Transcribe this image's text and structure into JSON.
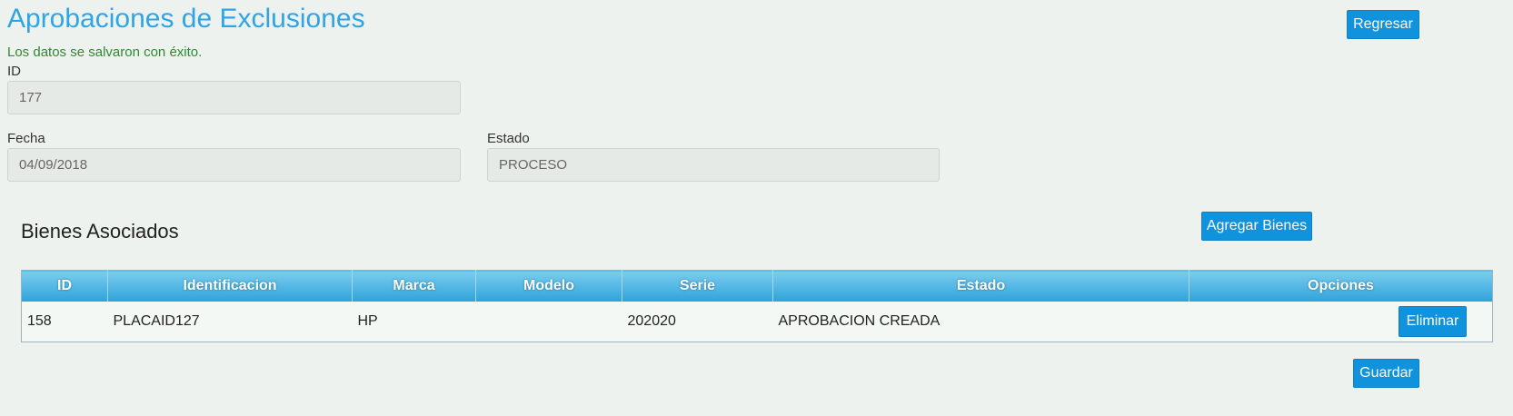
{
  "page": {
    "title": "Aprobaciones de Exclusiones",
    "success_message": "Los datos se salvaron con éxito.",
    "back_button": "Regresar",
    "save_button": "Guardar"
  },
  "form": {
    "id_label": "ID",
    "id_value": "177",
    "fecha_label": "Fecha",
    "fecha_value": "04/09/2018",
    "estado_label": "Estado",
    "estado_value": "PROCESO"
  },
  "assets": {
    "section_title": "Bienes Asociados",
    "add_button": "Agregar Bienes",
    "columns": [
      "ID",
      "Identificacion",
      "Marca",
      "Modelo",
      "Serie",
      "Estado",
      "Opciones"
    ],
    "rows": [
      {
        "id": "158",
        "identificacion": "PLACAID127",
        "marca": "HP",
        "modelo": "",
        "serie": "202020",
        "estado": "APROBACION CREADA",
        "action": "Eliminar"
      }
    ]
  },
  "colors": {
    "accent": "#2fa4e7",
    "button": "#1192dd",
    "success": "#2e8b2e",
    "background": "#eef2ef"
  }
}
